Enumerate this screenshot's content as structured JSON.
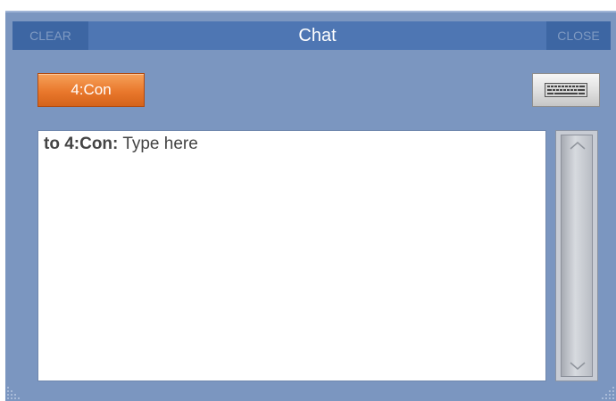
{
  "titlebar": {
    "clear_label": "CLEAR",
    "title": "Chat",
    "close_label": "CLOSE"
  },
  "recipient": {
    "label": "4:Con",
    "color": "#e9782c"
  },
  "keyboard": {
    "icon": "keyboard-icon"
  },
  "message": {
    "prefix": "to 4:Con:",
    "placeholder": "Type here"
  },
  "colors": {
    "window_bg": "#7b96c0",
    "titlebar_bg": "#4e76b3",
    "titlebar_button_bg": "#3d66a3"
  }
}
